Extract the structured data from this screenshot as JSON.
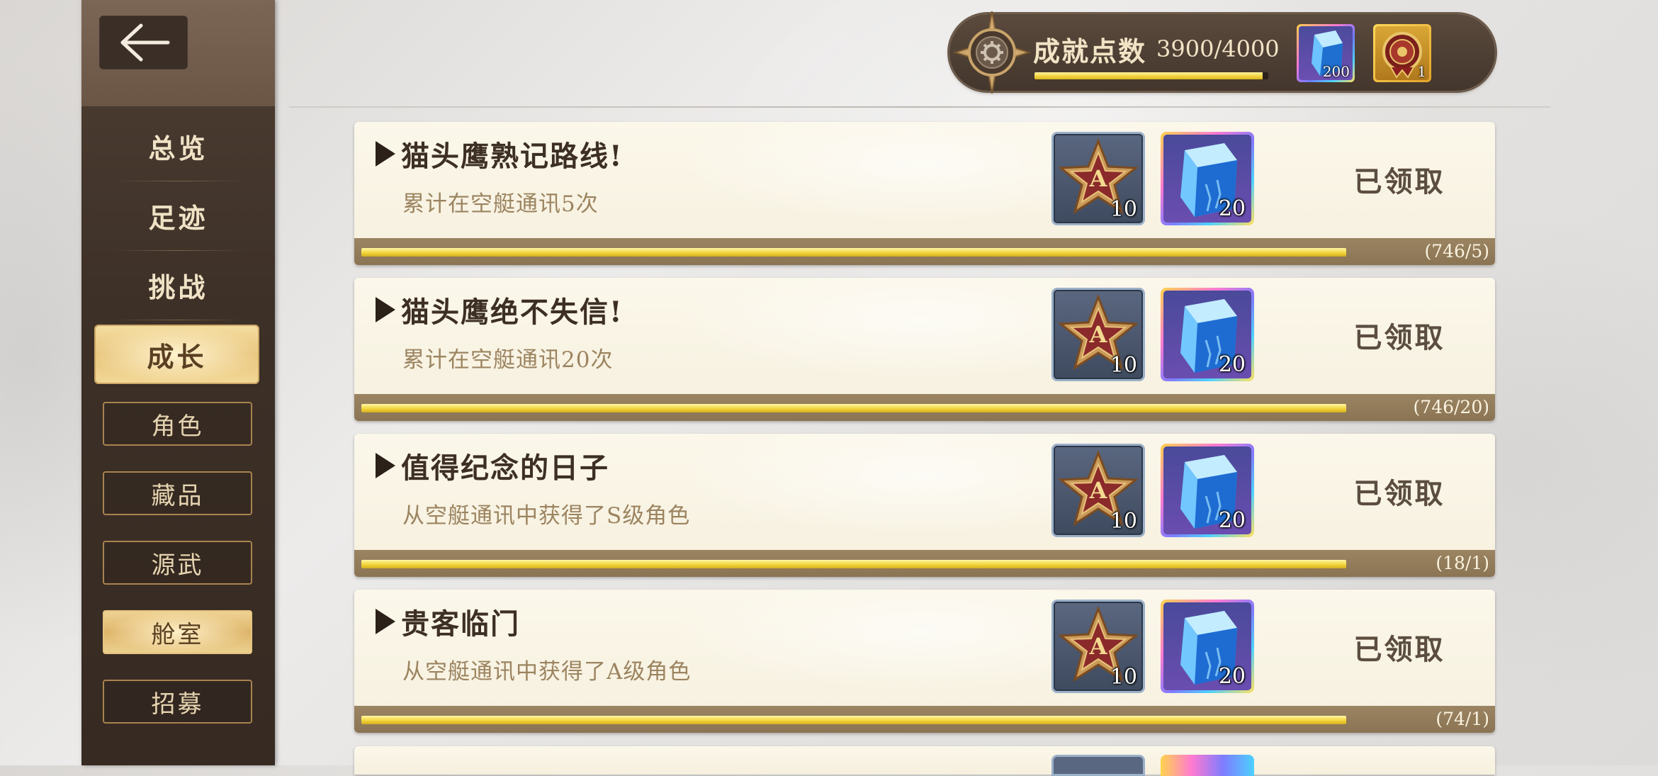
{
  "colors": {
    "sidebar_bg": "#3d3027",
    "active_gold": "#e8c57c",
    "progress_yellow": "#f3d63c",
    "card_bg": "#f8f3e4",
    "strip_brown": "#8a7453"
  },
  "sidebar": {
    "back_icon": "back-arrow-icon",
    "nav": [
      {
        "label": "总览",
        "active": false
      },
      {
        "label": "足迹",
        "active": false
      },
      {
        "label": "挑战",
        "active": false
      },
      {
        "label": "成长",
        "active": true
      }
    ],
    "sub": [
      {
        "label": "角色",
        "active": false
      },
      {
        "label": "藏品",
        "active": false
      },
      {
        "label": "源武",
        "active": false
      },
      {
        "label": "舱室",
        "active": true
      },
      {
        "label": "招募",
        "active": false
      }
    ]
  },
  "header": {
    "emblem_icon": "compass-emblem-icon",
    "points_label": "成就点数",
    "points_value": "3900/4000",
    "points_fraction": 0.975,
    "rewards": [
      {
        "icon": "blue-crystal-icon",
        "count": "200"
      },
      {
        "icon": "red-medal-icon",
        "count": "1"
      }
    ]
  },
  "achievements": [
    {
      "title": "猫头鹰熟记路线!",
      "desc": "累计在空艇通讯5次",
      "rewards": [
        {
          "icon": "star-badge-a-icon",
          "count": "10"
        },
        {
          "icon": "blue-crystal-icon",
          "count": "20"
        }
      ],
      "status": "已领取",
      "progress": "(746/5)",
      "fill": 1.0
    },
    {
      "title": "猫头鹰绝不失信!",
      "desc": "累计在空艇通讯20次",
      "rewards": [
        {
          "icon": "star-badge-a-icon",
          "count": "10"
        },
        {
          "icon": "blue-crystal-icon",
          "count": "20"
        }
      ],
      "status": "已领取",
      "progress": "(746/20)",
      "fill": 1.0
    },
    {
      "title": "值得纪念的日子",
      "desc": "从空艇通讯中获得了S级角色",
      "rewards": [
        {
          "icon": "star-badge-a-icon",
          "count": "10"
        },
        {
          "icon": "blue-crystal-icon",
          "count": "20"
        }
      ],
      "status": "已领取",
      "progress": "(18/1)",
      "fill": 1.0
    },
    {
      "title": "贵客临门",
      "desc": "从空艇通讯中获得了A级角色",
      "rewards": [
        {
          "icon": "star-badge-a-icon",
          "count": "10"
        },
        {
          "icon": "blue-crystal-icon",
          "count": "20"
        }
      ],
      "status": "已领取",
      "progress": "(74/1)",
      "fill": 1.0
    }
  ]
}
